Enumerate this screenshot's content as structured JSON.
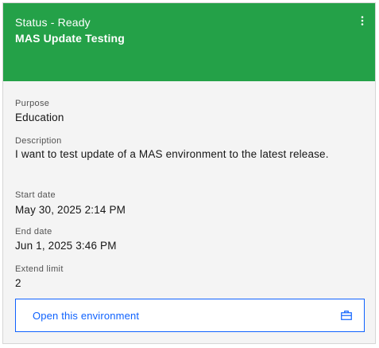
{
  "card": {
    "status": "Status - Ready",
    "title": "MAS Update Testing",
    "overflow_icon": "overflow-menu-vertical-icon",
    "header_color": "#24a148"
  },
  "fields": {
    "purpose": {
      "label": "Purpose",
      "value": "Education"
    },
    "description": {
      "label": "Description",
      "value": "I want to test update of a MAS environment to the latest release."
    },
    "start_date": {
      "label": "Start date",
      "value": "May 30, 2025 2:14 PM"
    },
    "end_date": {
      "label": "End date",
      "value": "Jun 1, 2025 3:46 PM"
    },
    "extend_limit": {
      "label": "Extend limit",
      "value": "2"
    }
  },
  "action": {
    "open_label": "Open this environment",
    "open_icon": "briefcase-icon",
    "accent_color": "#0f62fe"
  }
}
